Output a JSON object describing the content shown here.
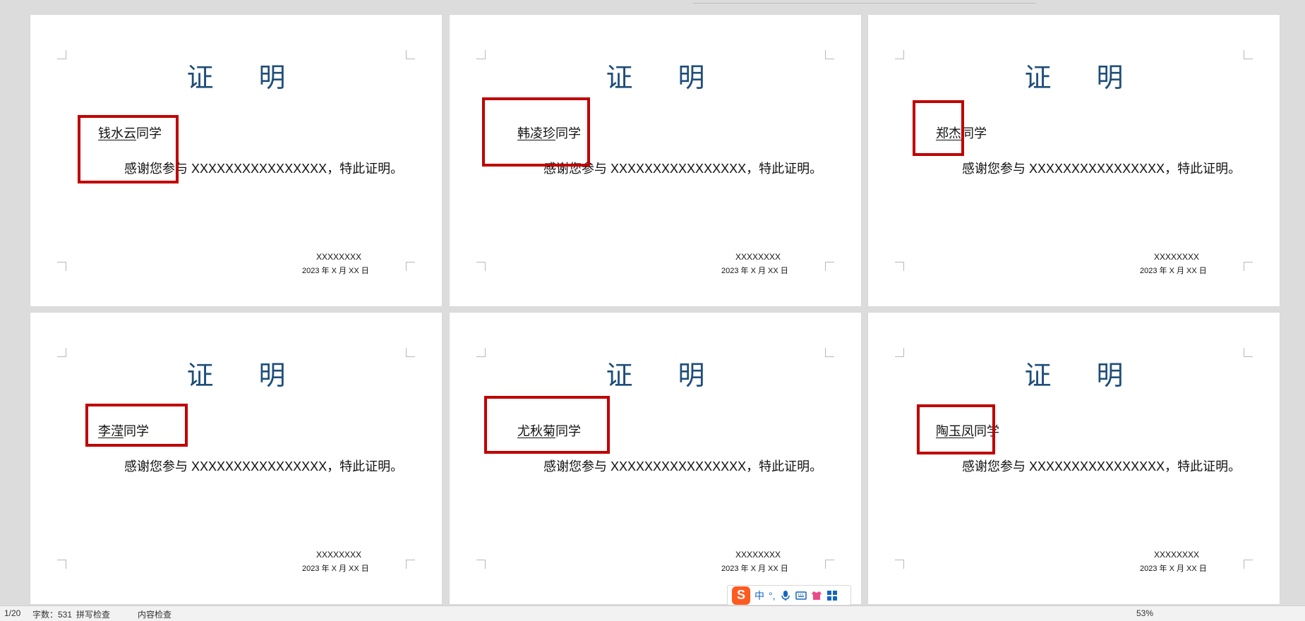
{
  "document": {
    "title_text": "证 明",
    "salutation_suffix": "同学",
    "body": "感谢您参与 XXXXXXXXXXXXXXXX，特此证明。",
    "organization": "XXXXXXXX",
    "date": "2023 年 X 月 XX 日"
  },
  "certificates": [
    {
      "name": "钱水云"
    },
    {
      "name": "韩凌珍"
    },
    {
      "name": "郑杰"
    },
    {
      "name": "李滢"
    },
    {
      "name": "尤秋菊"
    },
    {
      "name": "陶玉凤"
    }
  ],
  "ime": {
    "lang": "中",
    "punct": "°,"
  },
  "statusbar": {
    "page": "1/20",
    "word_count": "字数：531",
    "spell_check": "拼写检查",
    "content_check": "内容检查",
    "zoom": "53%"
  },
  "colors": {
    "title": "#1f4e79",
    "highlight": "#c00000"
  }
}
